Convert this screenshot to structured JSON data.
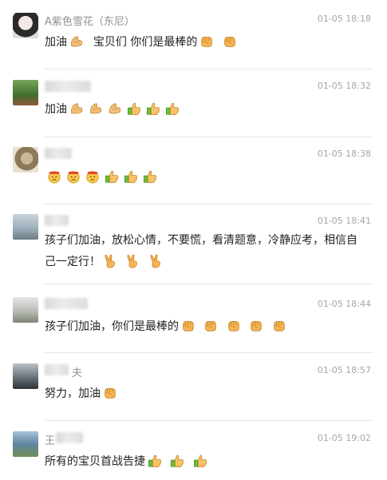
{
  "comments": [
    {
      "name": "A紫色雪花（东尼）",
      "time": "01-05 18:18",
      "text": "加油",
      "text2": "宝贝们 你们是最棒的",
      "tail": ""
    },
    {
      "name": "",
      "time": "01-05 18:32",
      "text": "加油",
      "text2": "",
      "tail": ""
    },
    {
      "name": "",
      "time": "01-05 18:38",
      "text": "",
      "text2": "",
      "tail": ""
    },
    {
      "name": "",
      "time": "01-05 18:41",
      "text": "孩子们加油，放松心情，不要慌，看清题意，冷静应考，相信自",
      "text2": "己一定行！",
      "tail": ""
    },
    {
      "name": "",
      "time": "01-05 18:44",
      "text": "孩子们加油，你们是最棒的",
      "text2": "",
      "tail": ""
    },
    {
      "name": "夫",
      "time": "01-05 18:57",
      "text": "努力，加油",
      "text2": "",
      "tail": ""
    },
    {
      "name": "王",
      "time": "01-05 19:02",
      "text": "所有的宝贝首战告捷",
      "text2": "",
      "tail": ""
    }
  ],
  "icons": {
    "muscle": "flexed-biceps-icon",
    "fist": "raised-fist-icon",
    "thumb": "thumbs-up-icon",
    "victory": "victory-hand-icon",
    "struggle": "struggle-face-icon"
  },
  "colors": {
    "name": "#8f8f8f",
    "time": "#a6a6a6",
    "text": "#222222",
    "divider": "#e8e8e8",
    "emoji_skin": "#f5b456"
  }
}
